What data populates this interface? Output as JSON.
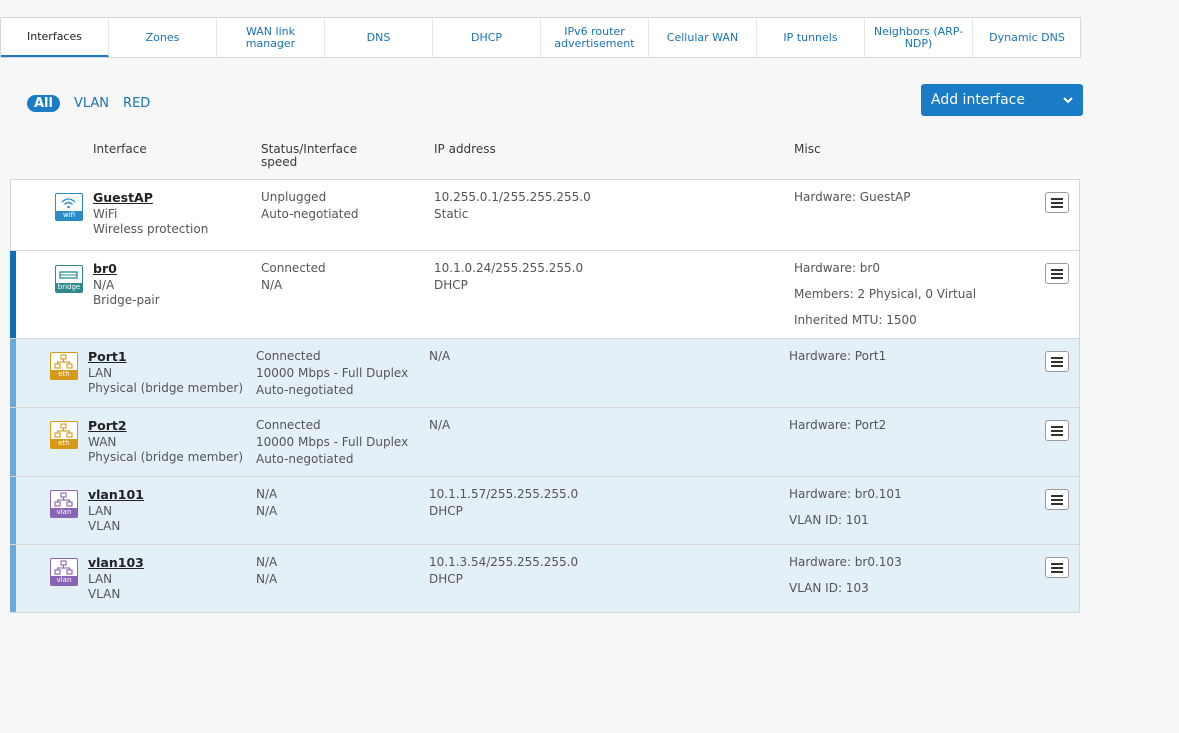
{
  "tabs": [
    {
      "label": "Interfaces",
      "active": true
    },
    {
      "label": "Zones"
    },
    {
      "label": "WAN link manager"
    },
    {
      "label": "DNS"
    },
    {
      "label": "DHCP"
    },
    {
      "label": "IPv6 router advertisement"
    },
    {
      "label": "Cellular WAN"
    },
    {
      "label": "IP tunnels"
    },
    {
      "label": "Neighbors (ARP-NDP)"
    },
    {
      "label": "Dynamic DNS"
    }
  ],
  "filters": {
    "all": "All",
    "vlan": "VLAN",
    "red": "RED"
  },
  "add_button": {
    "label": "Add interface"
  },
  "columns": {
    "interface": "Interface",
    "status": "Status/Interface speed",
    "ip": "IP address",
    "misc": "Misc"
  },
  "rows": [
    {
      "icon": "wifi-icon",
      "icon_label": "wifi",
      "name": "GuestAP",
      "zone": "WiFi",
      "type": "Wireless protection",
      "status": [
        "Unplugged",
        "Auto-negotiated"
      ],
      "ip": [
        "10.255.0.1/255.255.255.0",
        "Static"
      ],
      "misc": [
        "Hardware:  GuestAP"
      ]
    },
    {
      "icon": "bridge-icon",
      "icon_label": "bridge",
      "name": "br0",
      "zone": "N/A",
      "type": "Bridge-pair",
      "status": [
        "Connected",
        "N/A"
      ],
      "ip": [
        "10.1.0.24/255.255.255.0",
        "DHCP"
      ],
      "misc": [
        "Hardware:  br0",
        "Members: 2 Physical, 0 Virtual",
        "Inherited MTU: 1500"
      ]
    },
    {
      "icon": "ethernet-icon",
      "icon_label": "eth",
      "name": "Port1",
      "zone": "LAN",
      "type": "Physical (bridge member)",
      "status": [
        "Connected",
        "10000 Mbps - Full Duplex",
        "Auto-negotiated"
      ],
      "ip": [
        "N/A"
      ],
      "misc": [
        "Hardware:  Port1"
      ]
    },
    {
      "icon": "ethernet-icon",
      "icon_label": "eth",
      "name": "Port2",
      "zone": "WAN",
      "type": "Physical (bridge member)",
      "status": [
        "Connected",
        "10000 Mbps - Full Duplex",
        "Auto-negotiated"
      ],
      "ip": [
        "N/A"
      ],
      "misc": [
        "Hardware:  Port2"
      ]
    },
    {
      "icon": "vlan-icon",
      "icon_label": "vlan",
      "name": "vlan101",
      "zone": "LAN",
      "type": "VLAN",
      "status": [
        "N/A",
        "N/A"
      ],
      "ip": [
        "10.1.1.57/255.255.255.0",
        "DHCP"
      ],
      "misc": [
        "Hardware:  br0.101",
        "VLAN ID: 101"
      ]
    },
    {
      "icon": "vlan-icon",
      "icon_label": "vlan",
      "name": "vlan103",
      "zone": "LAN",
      "type": "VLAN",
      "status": [
        "N/A",
        "N/A"
      ],
      "ip": [
        "10.1.3.54/255.255.255.0",
        "DHCP"
      ],
      "misc": [
        "Hardware:  br0.103",
        "VLAN ID: 103"
      ]
    }
  ],
  "colors": {
    "accent": "#1a7bc7",
    "member_row_bg": "#e4f0f8",
    "wifi": "#2a8bc9",
    "bridge": "#2f8a8e",
    "eth": "#d69a16",
    "vlan": "#8a65b5"
  }
}
